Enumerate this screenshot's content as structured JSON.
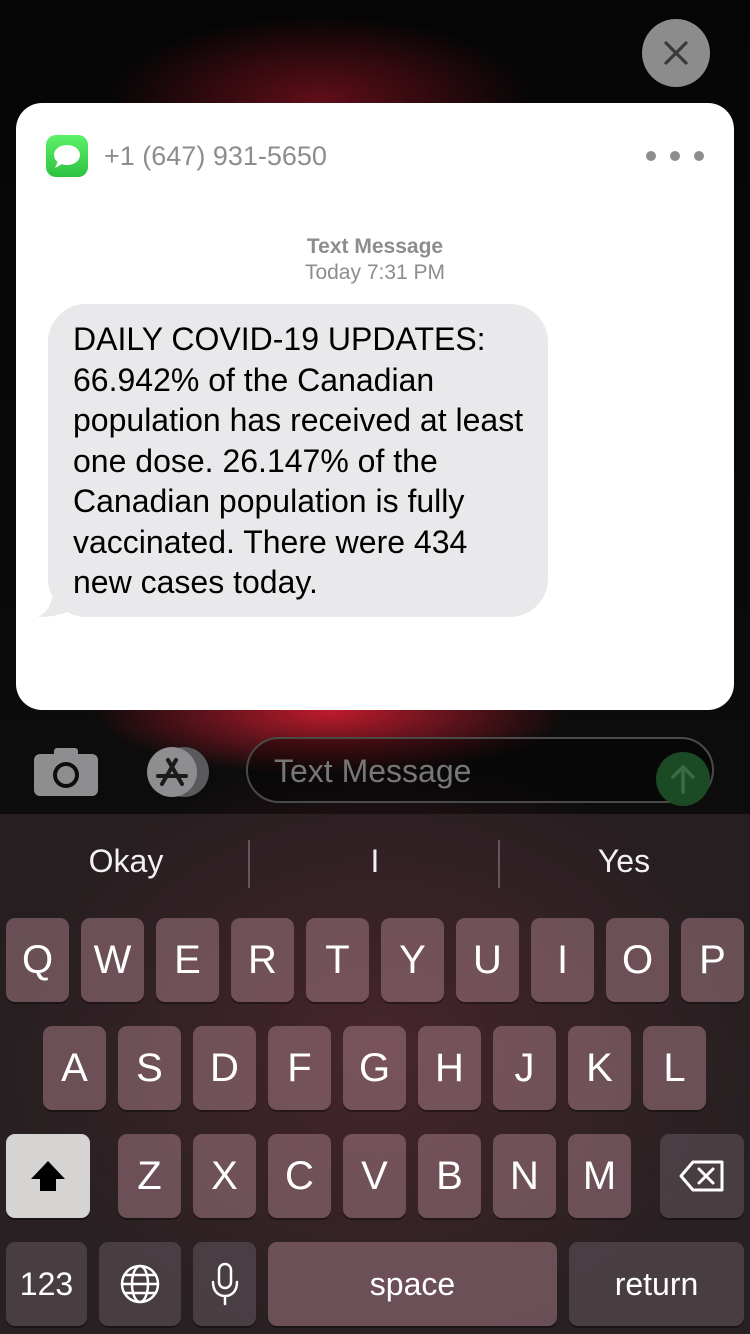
{
  "notification": {
    "sender": "+1 (647) 931-5650",
    "meta_label": "Text Message",
    "meta_time": "Today 7:31 PM",
    "message": "DAILY COVID-19 UPDATES: 66.942% of the Canadian population has received at least one dose. 26.147% of the Canadian population is fully vaccinated. There were 434 new cases today."
  },
  "compose": {
    "placeholder": "Text Message"
  },
  "suggestions": [
    "Okay",
    "I",
    "Yes"
  ],
  "keys": {
    "row1": [
      "Q",
      "W",
      "E",
      "R",
      "T",
      "Y",
      "U",
      "I",
      "O",
      "P"
    ],
    "row2": [
      "A",
      "S",
      "D",
      "F",
      "G",
      "H",
      "J",
      "K",
      "L"
    ],
    "row3": [
      "Z",
      "X",
      "C",
      "V",
      "B",
      "N",
      "M"
    ],
    "numbers": "123",
    "space": "space",
    "return": "return"
  },
  "icons": {
    "close": "close-icon",
    "app": "messages-app-icon",
    "more": "more-icon",
    "camera": "camera-icon",
    "appstore": "app-store-icon",
    "send": "send-arrow-icon",
    "shift": "shift-icon",
    "backspace": "backspace-icon",
    "globe": "globe-icon",
    "mic": "microphone-icon"
  },
  "colors": {
    "accent_green": "#34c759",
    "bubble_gray": "#e9e9eb"
  }
}
